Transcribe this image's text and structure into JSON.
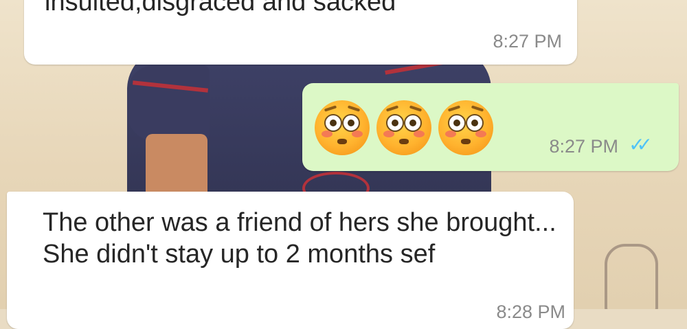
{
  "chat": {
    "messages": [
      {
        "direction": "incoming",
        "text": "insulted,disgraced and sacked",
        "time": "8:27 PM"
      },
      {
        "direction": "outgoing",
        "emojis": [
          "flushed-face",
          "flushed-face",
          "flushed-face"
        ],
        "time": "8:27 PM",
        "status": "read",
        "status_color": "#4fc3f7"
      },
      {
        "direction": "incoming",
        "text": "The other was a friend of hers she brought... She didn't stay up to 2 months sef",
        "time": "8:28 PM"
      }
    ]
  },
  "colors": {
    "incoming_bubble": "#ffffff",
    "outgoing_bubble": "#dcf8c6",
    "timestamp": "#8a8a8a"
  }
}
